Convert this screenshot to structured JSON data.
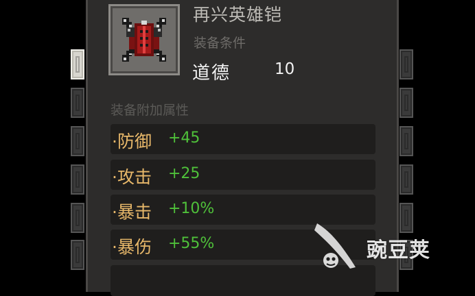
{
  "item": {
    "name": "再兴英雄铠",
    "icon": "armor-icon"
  },
  "requirement": {
    "title": "装备条件",
    "label": "道德",
    "value": "10"
  },
  "attributes": {
    "title": "装备附加属性",
    "stats": [
      {
        "label": "·防御",
        "value": "+45"
      },
      {
        "label": "·攻击",
        "value": "+25"
      },
      {
        "label": "·暴击",
        "value": "+10%"
      },
      {
        "label": "·暴伤",
        "value": "+55%"
      }
    ]
  },
  "watermark": {
    "text": "豌豆荚",
    "icon": "pea-pod-logo-icon"
  },
  "colors": {
    "panel_bg": "#2d2c2b",
    "stat_label": "#e8b86a",
    "stat_value": "#4fc13a"
  }
}
